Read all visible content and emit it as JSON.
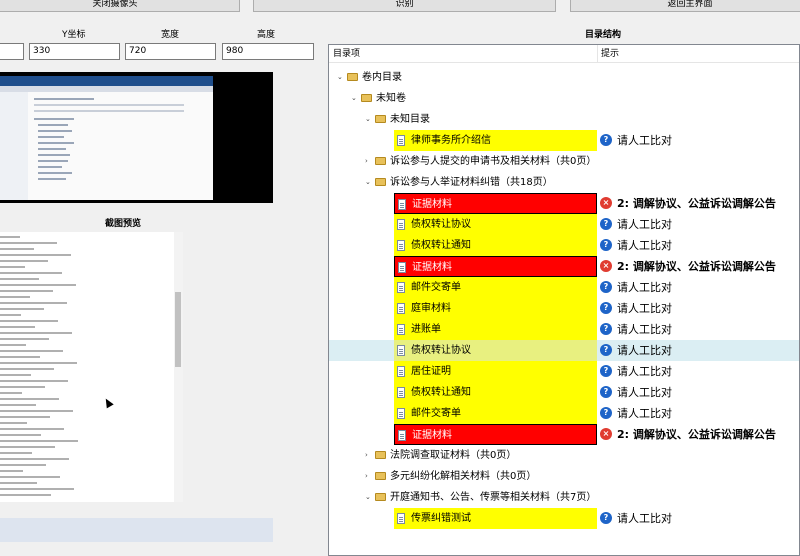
{
  "toolbar": {
    "close_camera": "关闭摄像头",
    "recognize": "识别",
    "back_main": "返回主界面"
  },
  "coords": {
    "y_label": "Y坐标",
    "width_label": "宽度",
    "height_label": "高度",
    "x_value": "",
    "y_value": "330",
    "width_value": "720",
    "height_value": "980"
  },
  "preview": {
    "title": "截图预览"
  },
  "tree": {
    "title": "目录结构",
    "col_item": "目录项",
    "col_hint": "提示",
    "rows": [
      {
        "label": "卷内目录",
        "type": "folder",
        "indent": 0,
        "expanded": true
      },
      {
        "label": "未知卷",
        "type": "folder",
        "indent": 1,
        "expanded": true
      },
      {
        "label": "未知目录",
        "type": "folder",
        "indent": 2,
        "expanded": true
      },
      {
        "label": "律师事务所介绍信",
        "type": "doc",
        "indent": 3,
        "style": "yellow",
        "hint": "请人工比对",
        "hint_type": "q"
      },
      {
        "label": "诉讼参与人提交的申请书及相关材料（共0页）",
        "type": "folder",
        "indent": 2,
        "expanded": false
      },
      {
        "label": "诉讼参与人举证材料纠错（共18页）",
        "type": "folder",
        "indent": 2,
        "expanded": true
      },
      {
        "label": "证据材料",
        "type": "doc",
        "indent": 3,
        "style": "red",
        "hint": "2: 调解协议、公益诉讼调解公告",
        "hint_type": "x"
      },
      {
        "label": "债权转让协议",
        "type": "doc",
        "indent": 3,
        "style": "yellow",
        "hint": "请人工比对",
        "hint_type": "q"
      },
      {
        "label": "债权转让通知",
        "type": "doc",
        "indent": 3,
        "style": "yellow",
        "hint": "请人工比对",
        "hint_type": "q"
      },
      {
        "label": "证据材料",
        "type": "doc",
        "indent": 3,
        "style": "red",
        "hint": "2: 调解协议、公益诉讼调解公告",
        "hint_type": "x"
      },
      {
        "label": "邮件交寄单",
        "type": "doc",
        "indent": 3,
        "style": "yellow",
        "hint": "请人工比对",
        "hint_type": "q"
      },
      {
        "label": "庭审材料",
        "type": "doc",
        "indent": 3,
        "style": "yellow",
        "hint": "请人工比对",
        "hint_type": "q"
      },
      {
        "label": "进账单",
        "type": "doc",
        "indent": 3,
        "style": "yellow",
        "hint": "请人工比对",
        "hint_type": "q"
      },
      {
        "label": "债权转让协议",
        "type": "doc",
        "indent": 3,
        "style": "selected",
        "hint": "请人工比对",
        "hint_type": "q"
      },
      {
        "label": "居住证明",
        "type": "doc",
        "indent": 3,
        "style": "yellow",
        "hint": "请人工比对",
        "hint_type": "q"
      },
      {
        "label": "债权转让通知",
        "type": "doc",
        "indent": 3,
        "style": "yellow",
        "hint": "请人工比对",
        "hint_type": "q"
      },
      {
        "label": "邮件交寄单",
        "type": "doc",
        "indent": 3,
        "style": "yellow",
        "hint": "请人工比对",
        "hint_type": "q"
      },
      {
        "label": "证据材料",
        "type": "doc",
        "indent": 3,
        "style": "red",
        "hint": "2: 调解协议、公益诉讼调解公告",
        "hint_type": "x"
      },
      {
        "label": "法院调查取证材料（共0页）",
        "type": "folder",
        "indent": 2,
        "expanded": false
      },
      {
        "label": "多元纠纷化解相关材料（共0页）",
        "type": "folder",
        "indent": 2,
        "expanded": false
      },
      {
        "label": "开庭通知书、公告、传票等相关材料（共7页）",
        "type": "folder",
        "indent": 2,
        "expanded": true
      },
      {
        "label": "传票纠错测试",
        "type": "doc",
        "indent": 3,
        "style": "yellow",
        "hint": "请人工比对",
        "hint_type": "q"
      }
    ]
  },
  "colors": {
    "highlight_yellow": "#ffff00",
    "error_red": "#ff0000",
    "info_blue": "#1e64c8",
    "error_icon": "#e03c31"
  },
  "icons": {
    "folder": "folder-icon",
    "doc": "document-icon",
    "question": "question-icon",
    "error": "error-icon"
  }
}
